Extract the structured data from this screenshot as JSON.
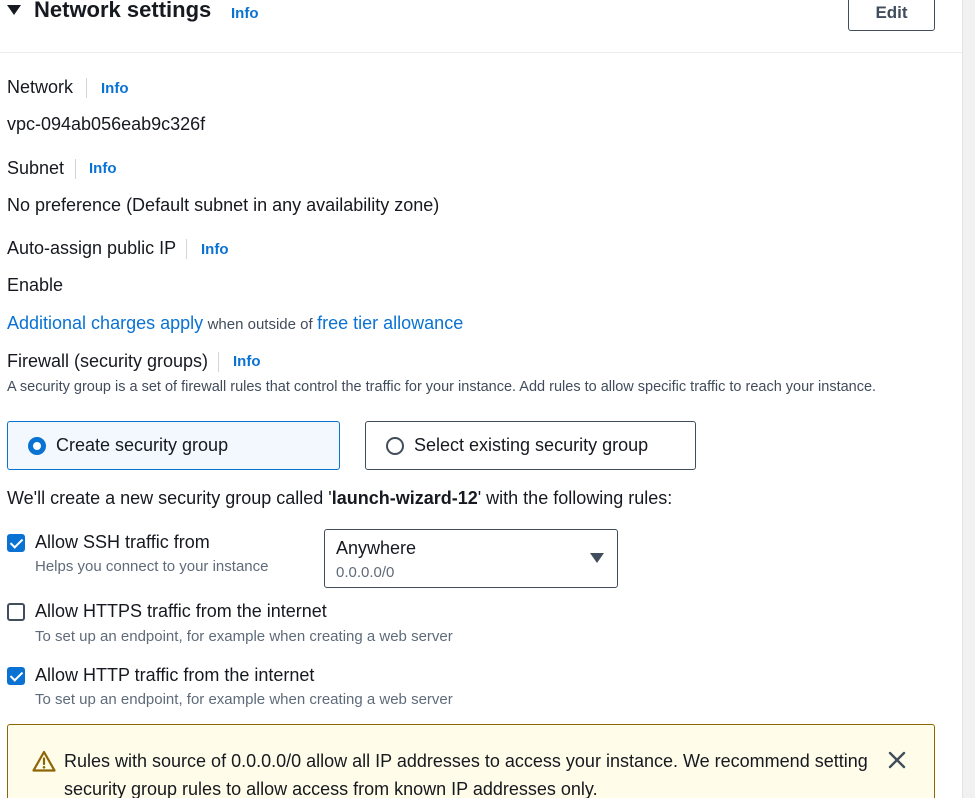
{
  "header": {
    "title": "Network settings",
    "info": "Info",
    "edit": "Edit"
  },
  "network": {
    "label": "Network",
    "info": "Info",
    "value": "vpc-094ab056eab9c326f"
  },
  "subnet": {
    "label": "Subnet",
    "info": "Info",
    "value": "No preference (Default subnet in any availability zone)"
  },
  "public_ip": {
    "label": "Auto-assign public IP",
    "info": "Info",
    "value": "Enable"
  },
  "charges": {
    "link1": "Additional charges apply",
    "middle": "when outside of",
    "link2": "free tier allowance"
  },
  "firewall": {
    "label": "Firewall (security groups)",
    "info": "Info",
    "description": "A security group is a set of firewall rules that control the traffic for your instance. Add rules to allow specific traffic to reach your instance.",
    "options": [
      "Create security group",
      "Select existing security group"
    ],
    "selected": "Create security group"
  },
  "sg_message": {
    "before": "We'll create a new security group called '",
    "name": "launch-wizard-12",
    "after": "' with the following rules:"
  },
  "rules": [
    {
      "label": "Allow SSH traffic from",
      "help": "Helps you connect to your instance",
      "checked": true
    },
    {
      "label": "Allow HTTPS traffic from the internet",
      "help": "To set up an endpoint, for example when creating a web server",
      "checked": false
    },
    {
      "label": "Allow HTTP traffic from the internet",
      "help": "To set up an endpoint, for example when creating a web server",
      "checked": true
    }
  ],
  "ssh_source": {
    "value": "Anywhere",
    "sub": "0.0.0.0/0"
  },
  "warning": {
    "text": "Rules with source of 0.0.0.0/0 allow all IP addresses to access your instance. We recommend setting security group rules to allow access from known IP addresses only."
  },
  "icons": {
    "collapse": "caret-down-icon",
    "dropdown": "caret-down-icon",
    "warning": "warning-triangle-icon",
    "close": "close-icon"
  },
  "colors": {
    "link": "#0972d3",
    "checkbox": "#0972d3",
    "warning_bg": "#fffce9",
    "warning_border": "#8d6605"
  }
}
